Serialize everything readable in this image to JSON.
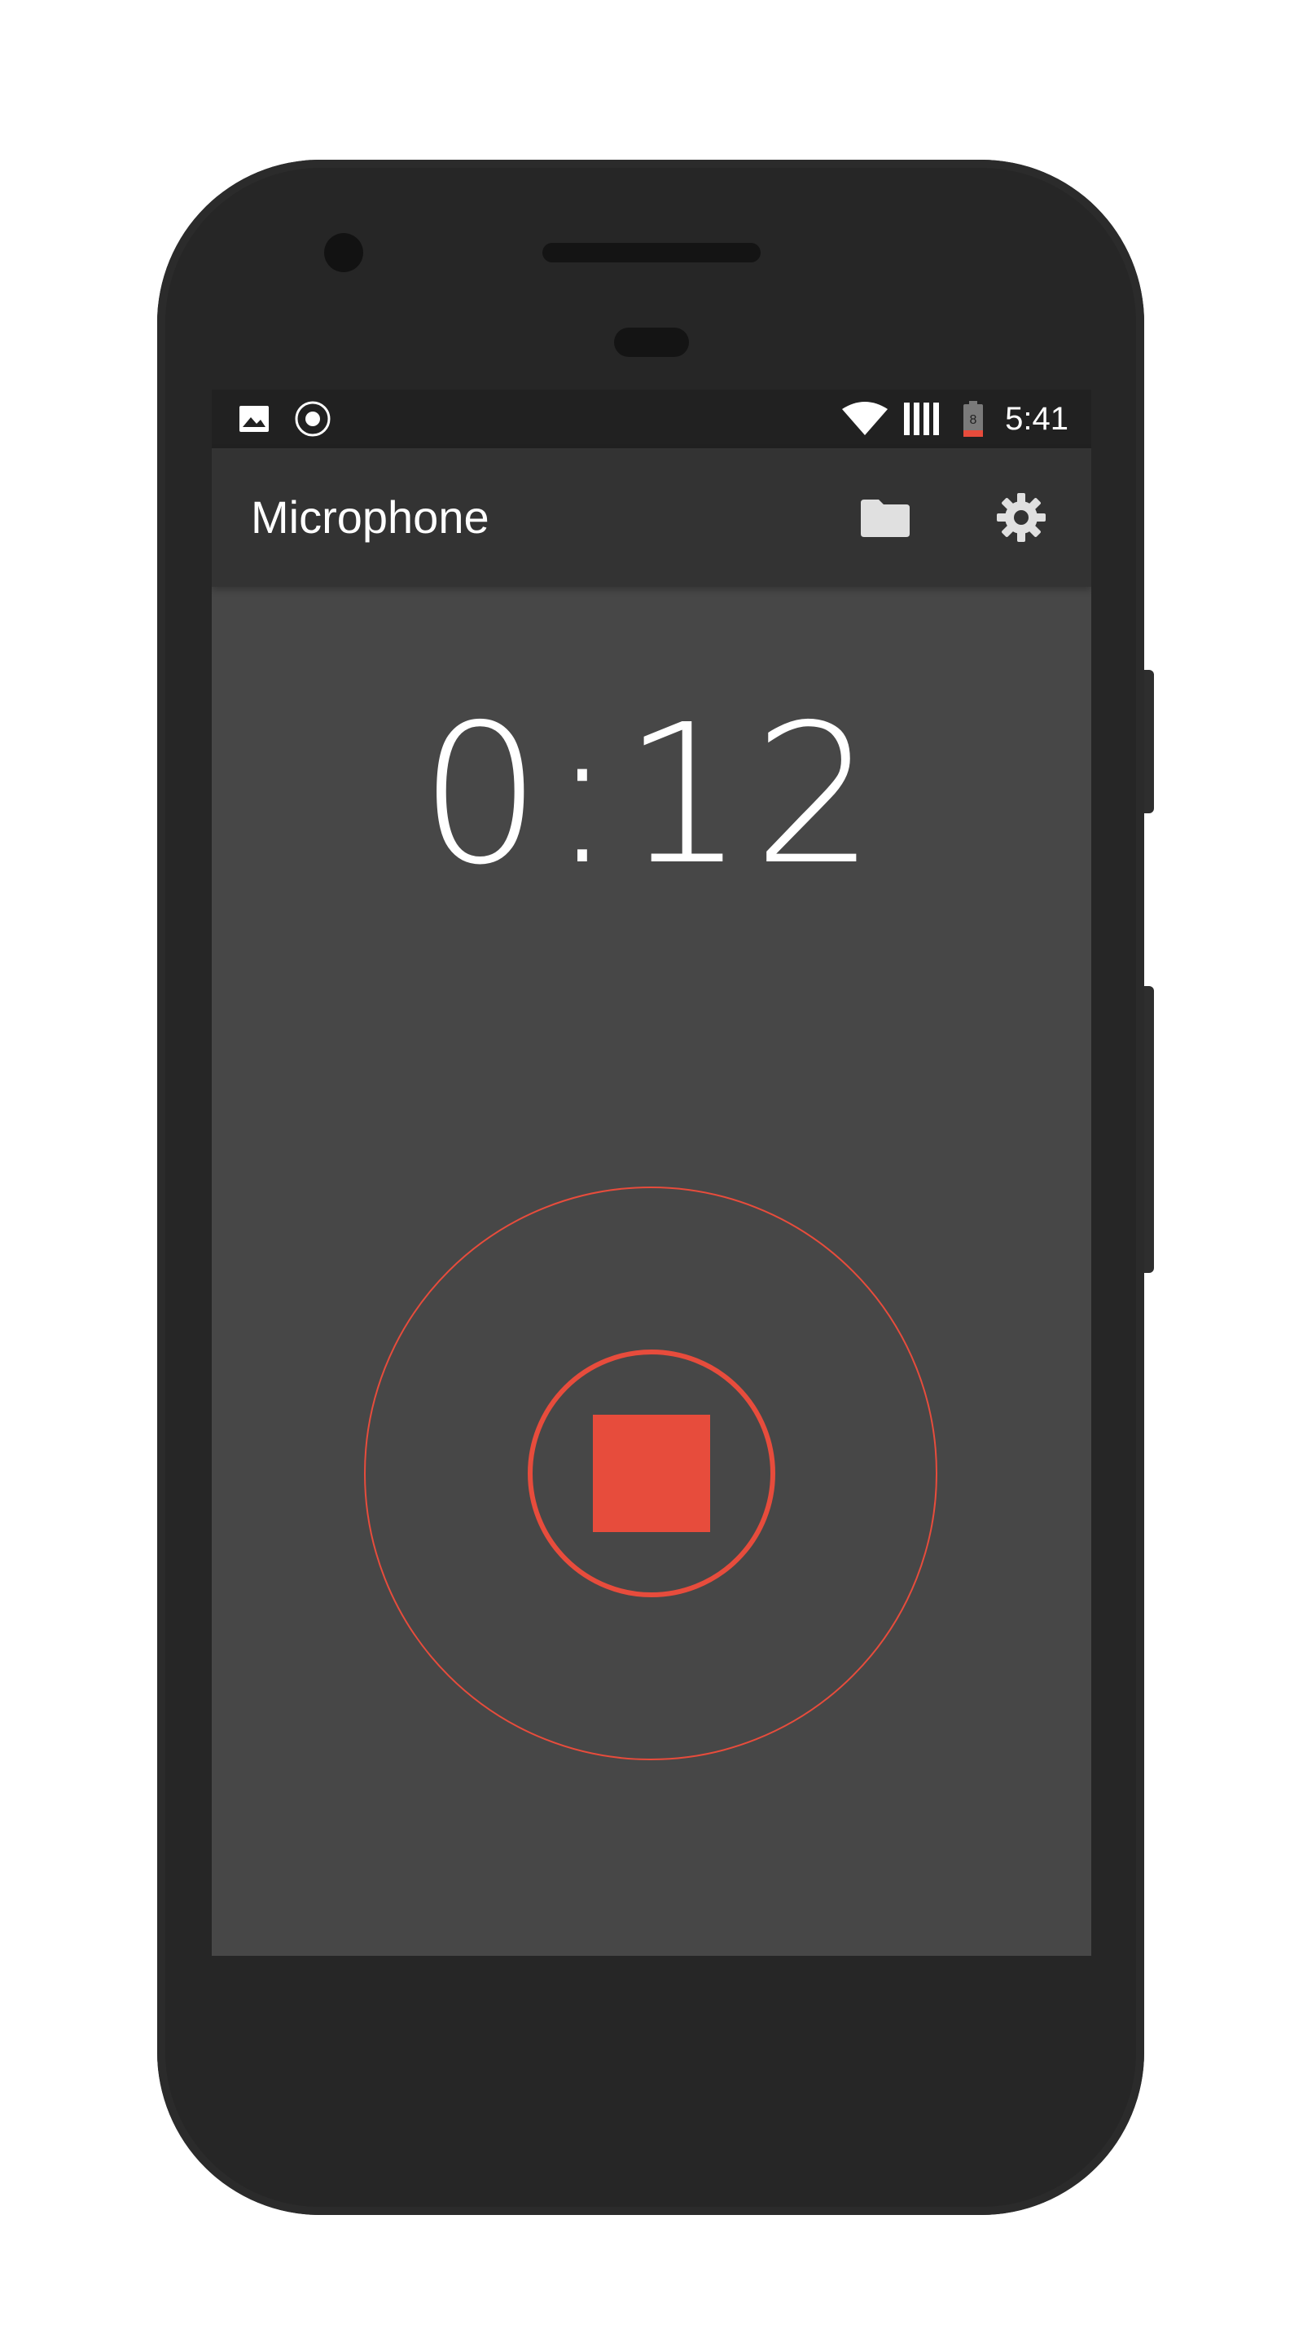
{
  "status_bar": {
    "time": "5:41",
    "battery_level": "8",
    "icons": [
      "image-icon",
      "record-indicator-icon",
      "wifi-icon",
      "signal-icon",
      "battery-icon"
    ]
  },
  "app_bar": {
    "title": "Microphone",
    "actions": [
      "folder-icon",
      "settings-gear-icon"
    ]
  },
  "recorder": {
    "elapsed": "0:12",
    "state": "recording",
    "accent_color": "#e74c3c"
  },
  "colors": {
    "screen_bg": "#474747",
    "app_bar_bg": "#333333",
    "status_bar_bg": "#212121",
    "phone_body": "#262626"
  }
}
